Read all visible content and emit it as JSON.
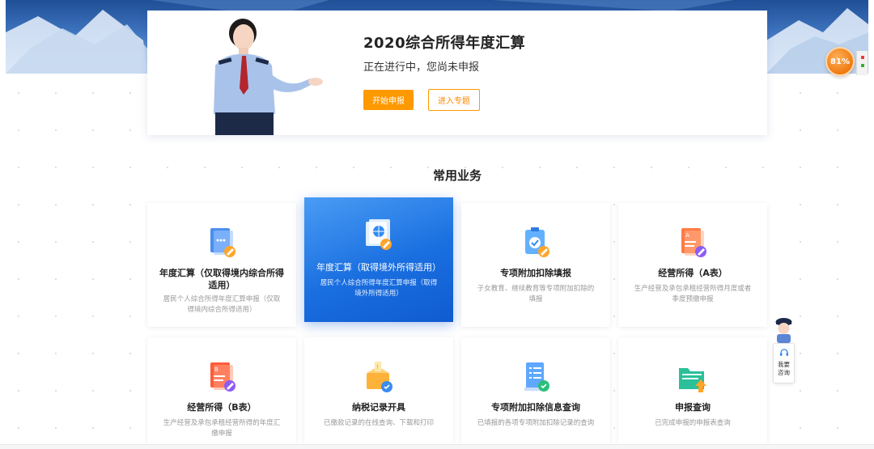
{
  "hero": {
    "title": "2020综合所得年度汇算",
    "status": "正在进行中，您尚未申报",
    "start_button": "开始申报",
    "topic_button": "进入专题"
  },
  "progress": {
    "percent_label": "81%"
  },
  "section": {
    "title": "常用业务"
  },
  "cards": [
    {
      "title": "年度汇算（仅取得境内综合所得适用）",
      "desc": "居民个人综合所得年度汇算申报（仅取得境内综合所得适用）",
      "icon": "document-edit-icon"
    },
    {
      "title": "年度汇算（取得境外所得适用）",
      "desc": "居民个人综合所得年度汇算申报（取得境外所得适用）",
      "icon": "globe-document-icon"
    },
    {
      "title": "专项附加扣除填报",
      "desc": "子女教育、继续教育等专项附加扣除的填报",
      "icon": "clipboard-check-icon"
    },
    {
      "title": "经营所得（A表）",
      "desc": "生产经营及承包承租经营所得月度或者季度预缴申报",
      "icon": "form-a-icon"
    },
    {
      "title": "经营所得（B表）",
      "desc": "生产经营及承包承租经营所得的年度汇缴申报",
      "icon": "form-b-icon"
    },
    {
      "title": "纳税记录开具",
      "desc": "已缴款记录的在线查询、下载和打印",
      "icon": "tax-record-box-icon"
    },
    {
      "title": "专项附加扣除信息查询",
      "desc": "已填报的各项专项附加扣除记录的查询",
      "icon": "list-query-icon"
    },
    {
      "title": "申报查询",
      "desc": "已完成申报的申报表查询",
      "icon": "folder-upload-icon"
    }
  ],
  "assistant": {
    "label_line1": "我要",
    "label_line2": "咨询"
  },
  "colors": {
    "accent": "#ff9900",
    "active_card": "#1a6fe0"
  }
}
